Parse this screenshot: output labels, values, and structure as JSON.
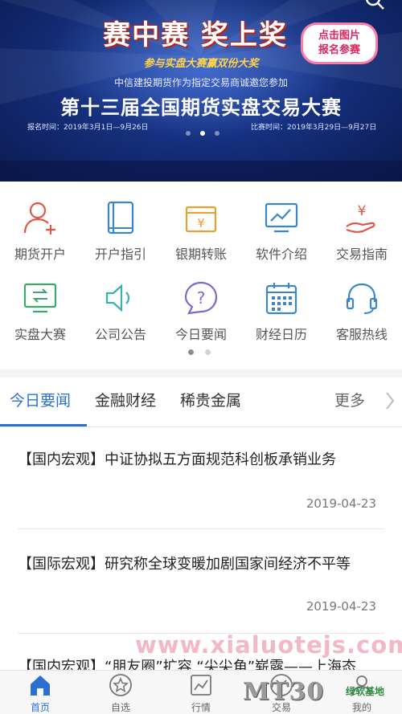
{
  "banner": {
    "title": "赛中赛 奖上奖",
    "subtitle": "参与实盘大赛赢双份大奖",
    "invite": "中信建投期货作为指定交易商诚邀您参加",
    "main_title": "第十三届全国期货实盘交易大赛",
    "signup_time": "报名时间：2019年3月1日—9月26日",
    "contest_time": "比赛时间：2019年3月29日—9月27日",
    "badge_line1": "点击图片",
    "badge_line2": "报名参赛",
    "search_icon": "search-icon",
    "carousel_count": 3,
    "carousel_active": 1
  },
  "quick_grid": {
    "row1": [
      {
        "label": "期货开户",
        "icon": "user-add-icon"
      },
      {
        "label": "开户指引",
        "icon": "book-icon"
      },
      {
        "label": "银期转账",
        "icon": "yuan-transfer-icon"
      },
      {
        "label": "软件介绍",
        "icon": "monitor-chart-icon"
      },
      {
        "label": "交易指南",
        "icon": "hand-yuan-icon"
      }
    ],
    "row2": [
      {
        "label": "实盘大赛",
        "icon": "trade-monitor-icon"
      },
      {
        "label": "公司公告",
        "icon": "speaker-icon"
      },
      {
        "label": "今日要闻",
        "icon": "question-bubble-icon"
      },
      {
        "label": "财经日历",
        "icon": "calendar-icon"
      },
      {
        "label": "客服热线",
        "icon": "headset-icon"
      }
    ],
    "page_count": 2,
    "page_active": 0
  },
  "news_tabs": {
    "tabs": [
      "今日要闻",
      "金融财经",
      "稀贵金属"
    ],
    "active": 0,
    "more_label": "更多"
  },
  "news": [
    {
      "title": "【国内宏观】中证协拟五方面规范科创板承销业务",
      "date": "2019-04-23"
    },
    {
      "title": "【国际宏观】研究称全球变暖加剧国家间经济不平等",
      "date": "2019-04-23"
    },
    {
      "title": "【国内宏观】“朋友圈”扩容 “尖尖角”崭露——上海态",
      "date": ""
    }
  ],
  "watermark": "www.xialuotejs.com",
  "bottom_nav": [
    {
      "label": "首页",
      "icon": "home-icon",
      "active": true
    },
    {
      "label": "自选",
      "icon": "star-icon",
      "active": false
    },
    {
      "label": "行情",
      "icon": "chart-icon",
      "active": false
    },
    {
      "label": "交易",
      "icon": "trade-icon",
      "active": false
    },
    {
      "label": "我的",
      "icon": "profile-icon",
      "active": false
    }
  ],
  "overlay_logo": "MT30",
  "overlay_logo_sub": "绿软基地",
  "colors": {
    "accent": "#2b6fd0",
    "icon_red": "#e0574a",
    "icon_orange": "#e8a030",
    "icon_blue": "#3a86c8",
    "icon_green": "#3aa86a",
    "icon_purple": "#7a6acb"
  }
}
